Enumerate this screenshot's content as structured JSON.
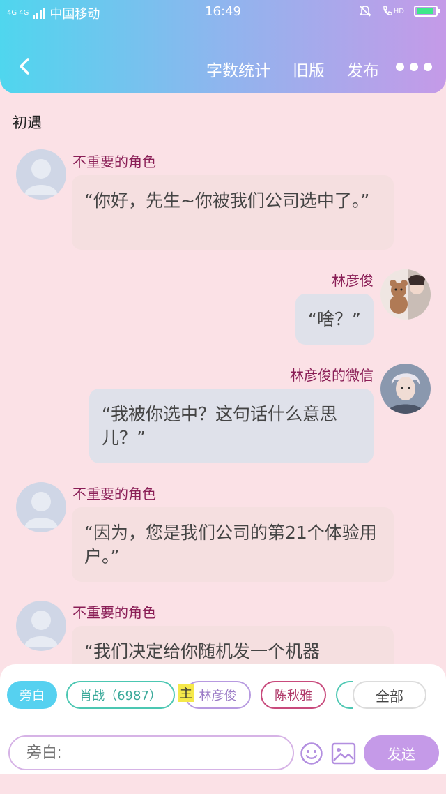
{
  "status_bar": {
    "network": "4G 4G",
    "carrier": "中国移动",
    "time": "16:49",
    "call_label": "HD"
  },
  "nav": {
    "actions": [
      "字数统计",
      "旧版",
      "发布"
    ]
  },
  "scene_title": "初遇",
  "messages": [
    {
      "side": "left",
      "name": "不重要的角色",
      "text": "“你好，先生~你被我们公司选中了。”",
      "avatar": "default-avatar"
    },
    {
      "side": "right",
      "name": "林彦俊",
      "text": "“啥？”",
      "avatar": "teddy-bear-avatar"
    },
    {
      "side": "right",
      "name": "林彦俊的微信",
      "text": "“我被你选中？这句话什么意思儿？”",
      "avatar": "person-avatar"
    },
    {
      "side": "left",
      "name": "不重要的角色",
      "text": "“因为，您是我们公司的第21个体验用户。”",
      "avatar": "default-avatar"
    },
    {
      "side": "left",
      "name": "不重要的角色",
      "text": "“我们决定给你随机发一个机器",
      "avatar": "default-avatar"
    }
  ],
  "characters": {
    "items": [
      "旁白",
      "肖战（6987）",
      "林彦俊",
      "陈秋雅",
      "",
      "全部"
    ],
    "main_badge": "主",
    "selected": "旁白"
  },
  "composer": {
    "placeholder": "旁白:",
    "send_label": "发送"
  },
  "colors": {
    "header_start": "#4fd6ee",
    "header_end": "#c59ae8",
    "name_color": "#8a1e56",
    "background": "#fbe1e6"
  }
}
